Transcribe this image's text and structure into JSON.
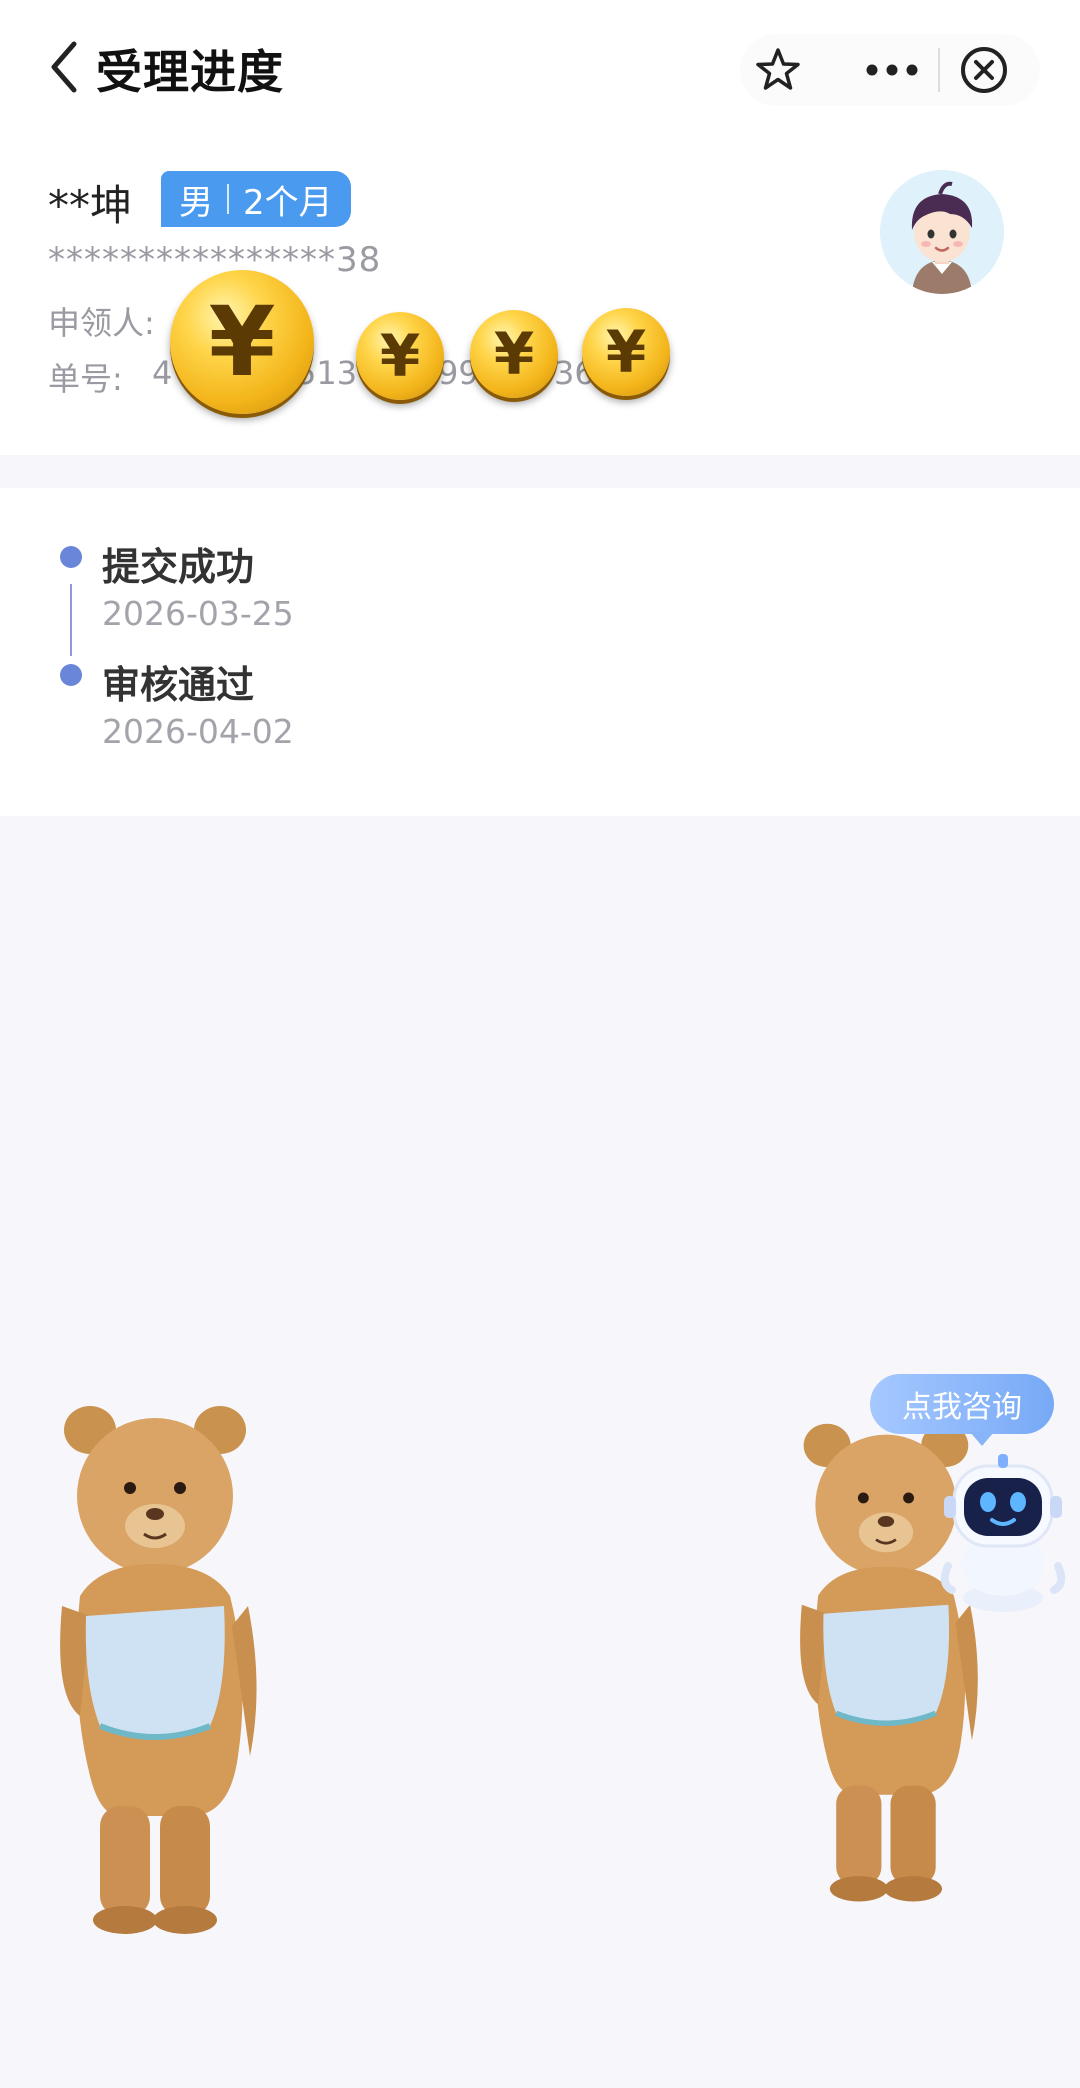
{
  "header": {
    "title": "受理进度",
    "back_icon": "chevron-left-icon",
    "favorite_icon": "star-icon",
    "more_icon": "more-dots-icon",
    "close_icon": "close-circle-icon"
  },
  "applicant": {
    "name": "**坤",
    "gender": "男",
    "age": "2个月",
    "id_masked": "****************38",
    "claimant_label": "申领人:",
    "order_label": "单号:",
    "order_visible_fragments": [
      "4",
      "513",
      "99",
      "36"
    ]
  },
  "timeline": [
    {
      "title": "提交成功",
      "date": "2026-03-25"
    },
    {
      "title": "审核通过",
      "date": "2026-04-02"
    }
  ],
  "coins": {
    "symbol": "¥",
    "count": 4
  },
  "assistant": {
    "bubble_text": "点我咨询"
  },
  "colors": {
    "accent_blue": "#4a9af0",
    "timeline_dot": "#6a86d8",
    "coin_gold": "#f3b51a",
    "background": "#f7f7fb"
  }
}
